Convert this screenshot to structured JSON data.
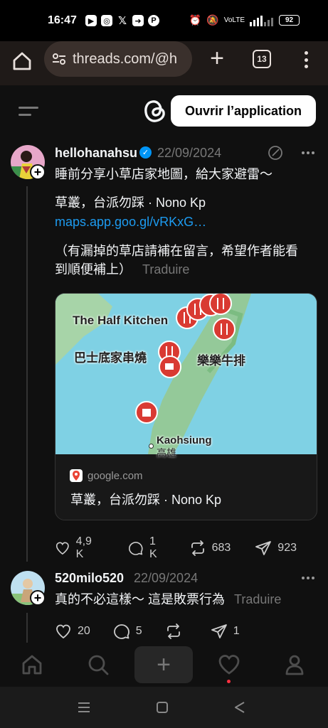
{
  "status_bar": {
    "time": "16:47",
    "notification_icons": [
      "youtube-icon",
      "instagram-icon",
      "x-icon",
      "share-icon",
      "p-icon"
    ],
    "battery": "92"
  },
  "browser": {
    "url": "threads.com/@h",
    "tab_count": "13"
  },
  "header": {
    "open_app_label": "Ouvrir l’application"
  },
  "posts": [
    {
      "username": "hellohanahsu",
      "verified": true,
      "date": "22/09/2024",
      "text_line1": "睡前分享小草店家地圖，給大家避雷～",
      "text_line2": "草叢，台派勿踩 · Nono Kp",
      "link": "maps.app.goo.gl/vRKxG…",
      "text_line3": "（有漏掉的草店請補在留言，希望作者能看",
      "text_line4": "到順便補上）",
      "translate": "Traduire",
      "card": {
        "map_labels": {
          "label1": "The Half Kitchen",
          "label2": "巴士底家串燒",
          "label3": "樂樂牛排",
          "label4": "Kaohsiung",
          "label5": "高雄"
        },
        "domain": "google.com",
        "title": "草叢，台派勿踩 · Nono Kp"
      },
      "likes": "4,9 K",
      "replies": "1 K",
      "reposts": "683",
      "shares": "923"
    },
    {
      "username": "520milo520",
      "verified": false,
      "date": "22/09/2024",
      "text_line1": "真的不必這樣～ 這是敗票行為",
      "translate": "Traduire",
      "likes": "20",
      "replies": "5",
      "reposts": "",
      "shares": "1"
    }
  ],
  "colors": {
    "background": "#101010",
    "link": "#1d9bf0",
    "verified": "#0095f6",
    "map_water": "#7fd1e4",
    "map_land": "#94c999",
    "pin": "#d93a32",
    "notification_dot": "#ff3040"
  }
}
